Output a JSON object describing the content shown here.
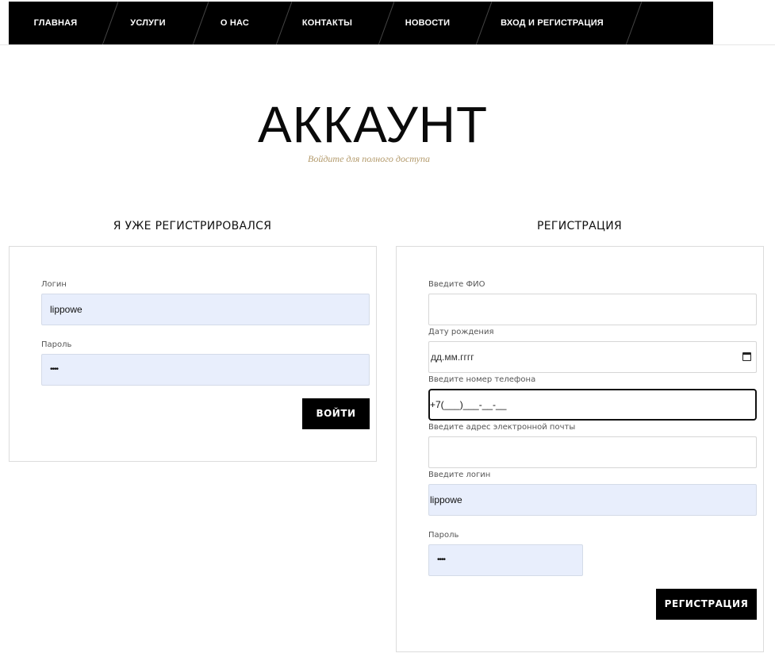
{
  "nav": {
    "items": [
      {
        "label": "ГЛАВНАЯ"
      },
      {
        "label": "УСЛУГИ"
      },
      {
        "label": "О НАС"
      },
      {
        "label": "КОНТАКТЫ"
      },
      {
        "label": "НОВОСТИ"
      },
      {
        "label": "ВХОД И РЕГИСТРАЦИЯ"
      }
    ]
  },
  "header": {
    "title": "АККАУНТ",
    "subtitle": "Войдите для полного доступа"
  },
  "login": {
    "heading": "Я УЖЕ РЕГИСТРИРОВАЛСЯ",
    "login_label": "Логин",
    "login_value": "lippowe",
    "password_label": "Пароль",
    "password_value": "••••",
    "submit_label": "ВОЙТИ"
  },
  "register": {
    "heading": "РЕГИСТРАЦИЯ",
    "fio_label": "Введите ФИО",
    "fio_value": "",
    "birth_label": "Дату рождения",
    "birth_placeholder": "дд.мм.гггг",
    "phone_label": "Введите номер телефона",
    "phone_value": "+7(___)___-__-__",
    "email_label": "Введите адрес электронной почты",
    "email_value": "",
    "login_label": "Введите логин",
    "login_value": "lippowe",
    "password_label": "Пароль",
    "password_value": "••••",
    "submit_label": "РЕГИСТРАЦИЯ"
  },
  "colors": {
    "accent": "#b39a6b",
    "nav_bg": "#000000",
    "autofill_bg": "#e8eefc"
  }
}
